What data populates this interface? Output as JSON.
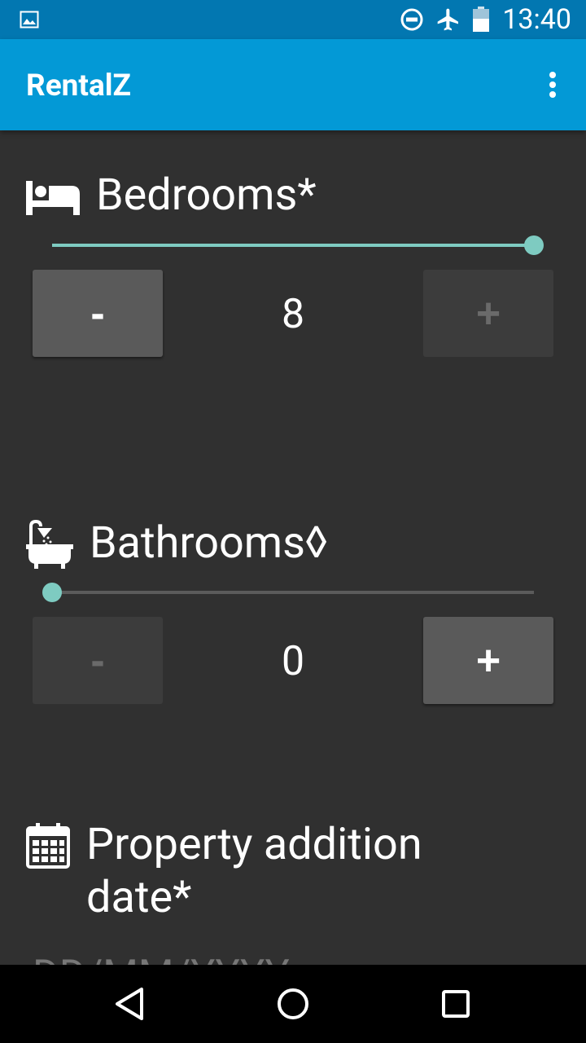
{
  "status_bar": {
    "time": "13:40",
    "icons": [
      "image-icon",
      "do-not-disturb-icon",
      "airplane-mode-icon",
      "battery-icon"
    ]
  },
  "app_bar": {
    "title": "RentalZ",
    "menu_icon": "more-vert-icon"
  },
  "bedrooms": {
    "icon": "bed-icon",
    "label": "Bedrooms*",
    "value": "8",
    "slider_level": 1.0,
    "decrement_label": "-",
    "increment_label": "+",
    "decrement_enabled": true,
    "increment_enabled": false
  },
  "bathrooms": {
    "icon": "bathtub-icon",
    "label": "Bathrooms◊",
    "value": "0",
    "slider_level": 0.0,
    "decrement_label": "-",
    "increment_label": "+",
    "decrement_enabled": false,
    "increment_enabled": true
  },
  "property_date": {
    "icon": "calendar-icon",
    "label_line1": "Property addition",
    "label_line2": "date*",
    "placeholder": "DD/MM/YYYY"
  },
  "nav_bar": {
    "icons": [
      "back-icon",
      "home-icon",
      "recents-icon"
    ]
  },
  "colors": {
    "status_bar": "#0277b1",
    "app_bar": "#0399d6",
    "background": "#303030",
    "accent": "#7ecbc1"
  }
}
